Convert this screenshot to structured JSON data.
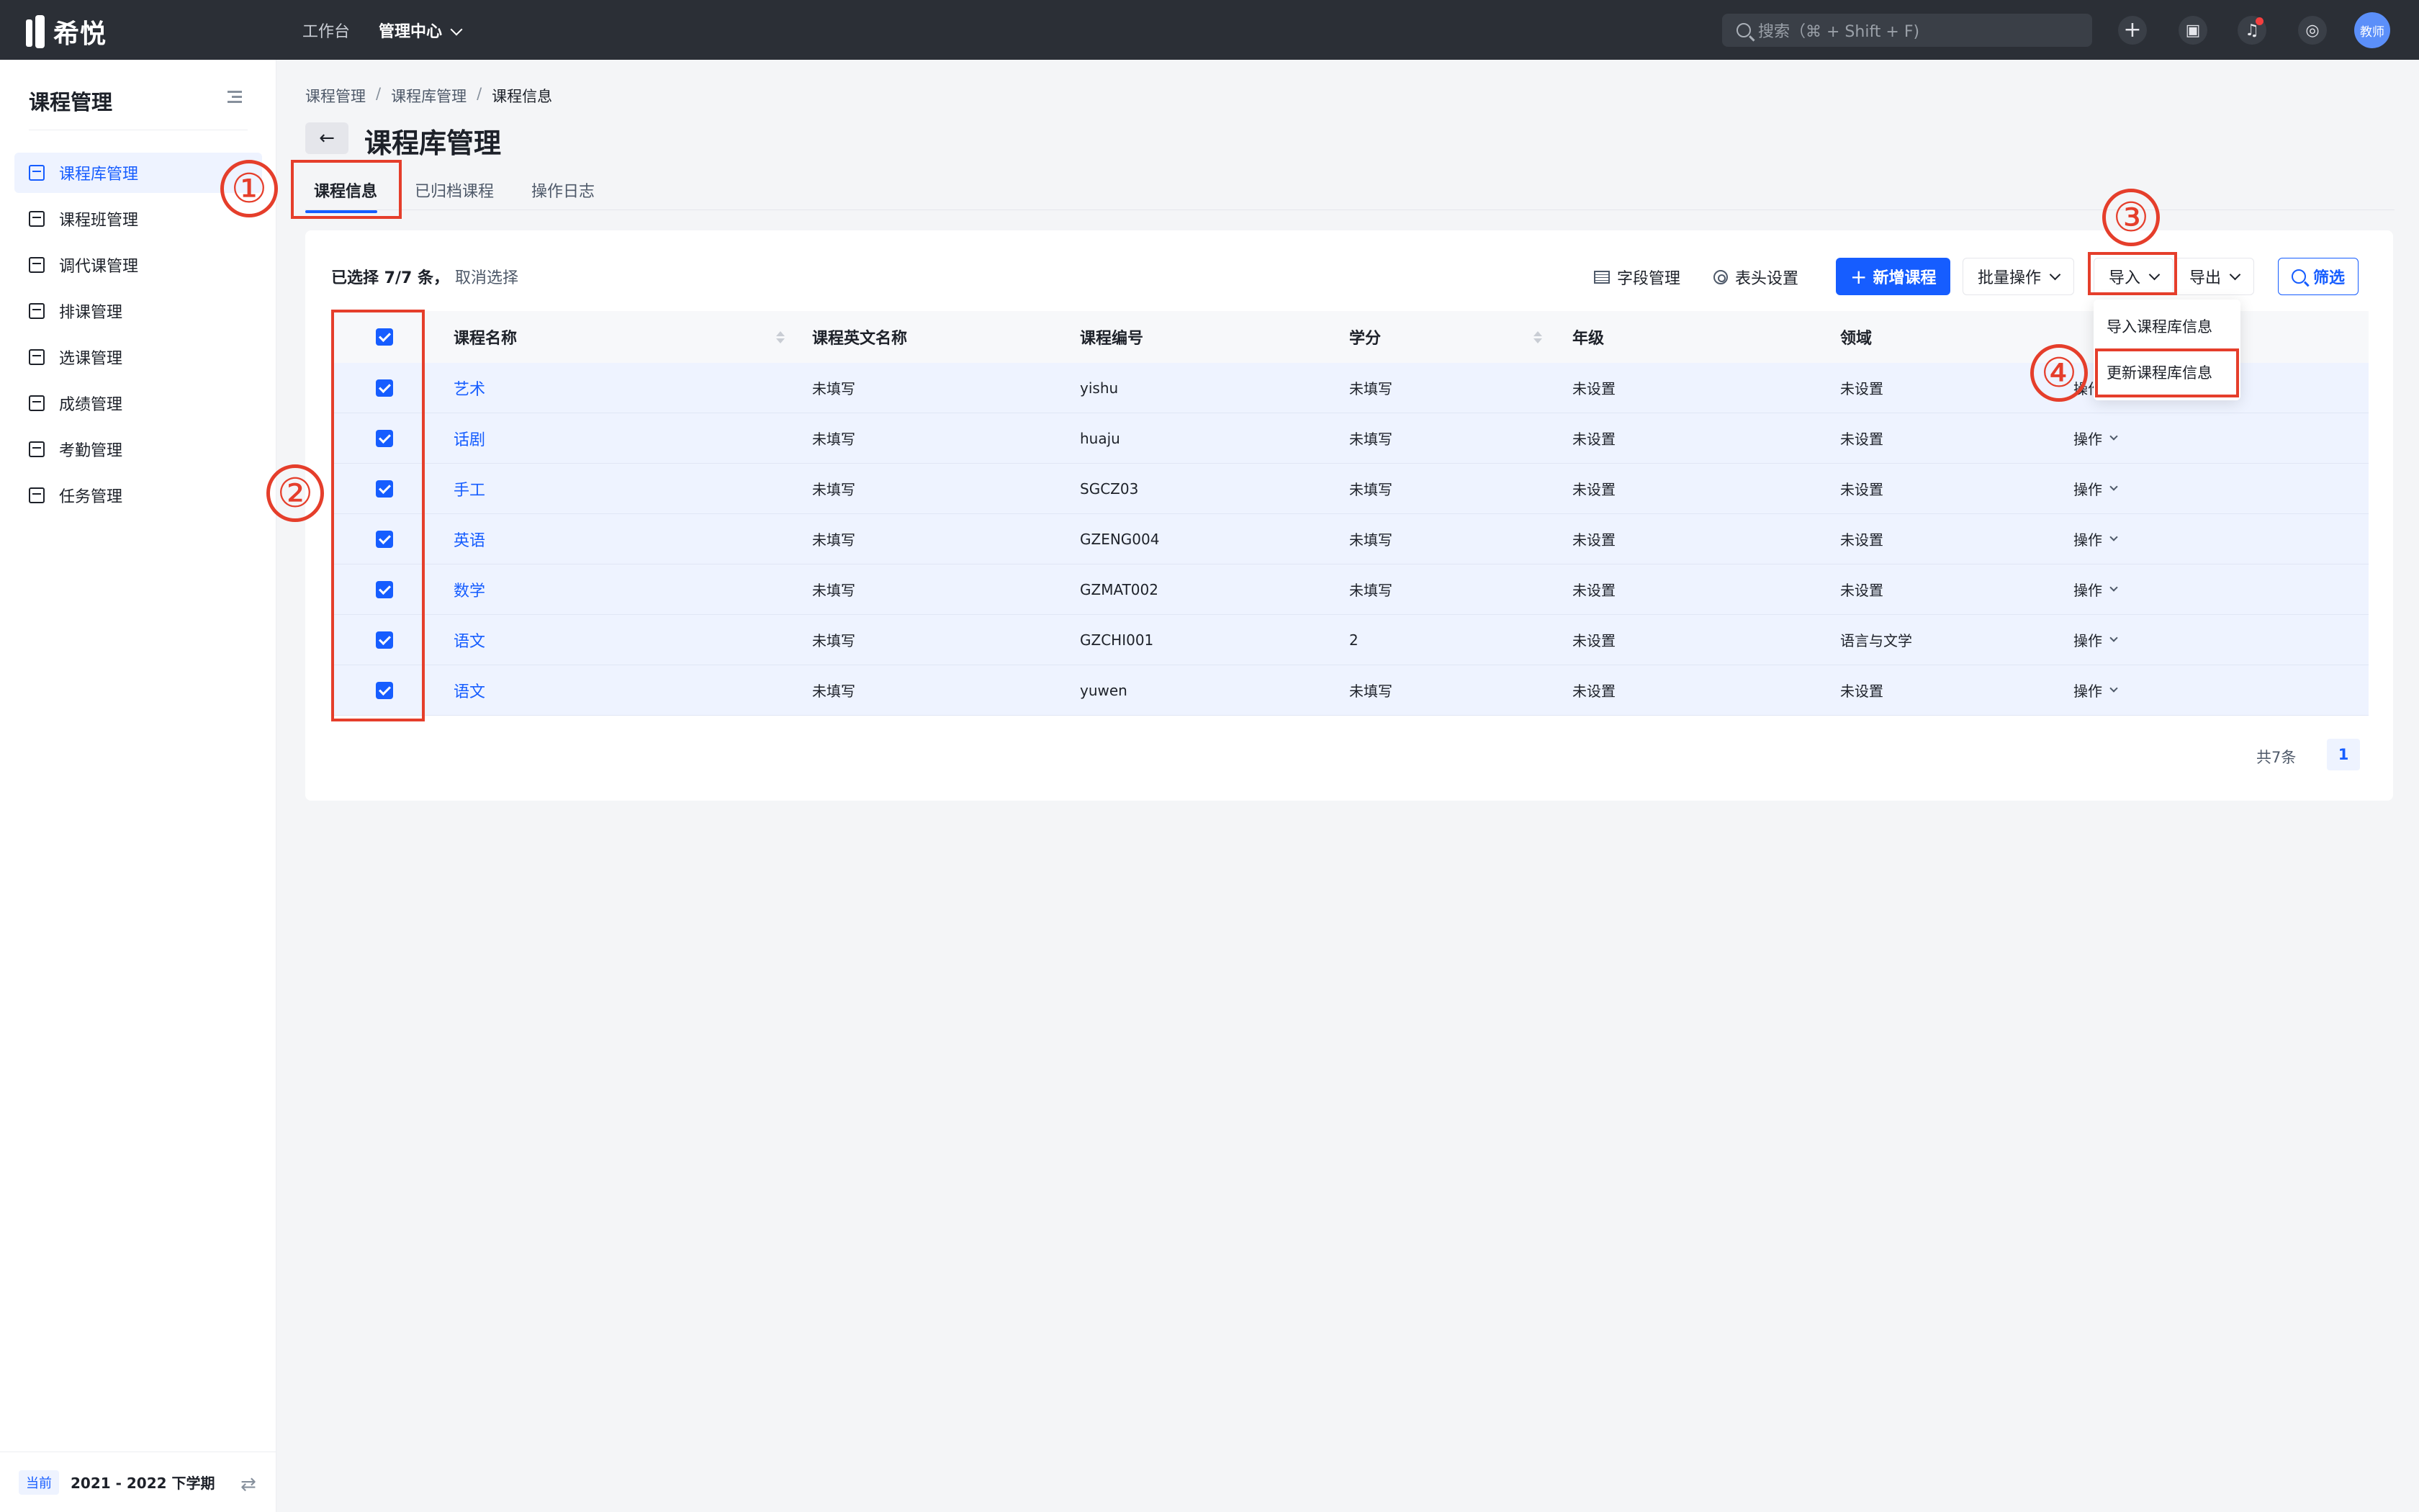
{
  "app": {
    "name": "希悦"
  },
  "topnav": {
    "workbench": "工作台",
    "admin_center": "管理中心",
    "search_placeholder": "搜索（⌘ + Shift + F)",
    "avatar": "教师"
  },
  "sidebar": {
    "title": "课程管理",
    "items": [
      {
        "label": "课程库管理",
        "active": true
      },
      {
        "label": "课程班管理"
      },
      {
        "label": "调代课管理"
      },
      {
        "label": "排课管理"
      },
      {
        "label": "选课管理"
      },
      {
        "label": "成绩管理"
      },
      {
        "label": "考勤管理"
      },
      {
        "label": "任务管理"
      }
    ],
    "term_badge": "当前",
    "term": "2021 - 2022 下学期"
  },
  "breadcrumb": [
    "课程管理",
    "课程库管理",
    "课程信息"
  ],
  "breadcrumb_sep": "/",
  "page": {
    "title": "课程库管理"
  },
  "tabs": [
    "课程信息",
    "已归档课程",
    "操作日志"
  ],
  "toolbar": {
    "selection": "已选择 7/7 条，",
    "cancel_selection": "取消选择",
    "field_manage": "字段管理",
    "header_settings": "表头设置",
    "add_course": "新增课程",
    "add_plus": "+",
    "batch_ops": "批量操作",
    "import": "导入",
    "export": "导出",
    "filter": "筛选"
  },
  "import_menu": [
    "导入课程库信息",
    "更新课程库信息"
  ],
  "table": {
    "columns": [
      "课程名称",
      "课程英文名称",
      "课程编号",
      "学分",
      "年级",
      "领域"
    ],
    "op_label": "操作",
    "rows": [
      {
        "name": "艺术",
        "en": "未填写",
        "code": "yishu",
        "credit": "未填写",
        "grade": "未设置",
        "domain": "未设置"
      },
      {
        "name": "话剧",
        "en": "未填写",
        "code": "huaju",
        "credit": "未填写",
        "grade": "未设置",
        "domain": "未设置"
      },
      {
        "name": "手工",
        "en": "未填写",
        "code": "SGCZ03",
        "credit": "未填写",
        "grade": "未设置",
        "domain": "未设置"
      },
      {
        "name": "英语",
        "en": "未填写",
        "code": "GZENG004",
        "credit": "未填写",
        "grade": "未设置",
        "domain": "未设置"
      },
      {
        "name": "数学",
        "en": "未填写",
        "code": "GZMAT002",
        "credit": "未填写",
        "grade": "未设置",
        "domain": "未设置"
      },
      {
        "name": "语文",
        "en": "未填写",
        "code": "GZCHI001",
        "credit": "2",
        "grade": "未设置",
        "domain": "语言与文学"
      },
      {
        "name": "语文",
        "en": "未填写",
        "code": "yuwen",
        "credit": "未填写",
        "grade": "未设置",
        "domain": "未设置"
      }
    ]
  },
  "pagination": {
    "total": "共7条",
    "current": "1"
  },
  "annotations": [
    "①",
    "②",
    "③",
    "④"
  ],
  "colors": {
    "primary": "#165dff",
    "annotation": "#e53e2b",
    "topbar": "#2b2f36"
  }
}
